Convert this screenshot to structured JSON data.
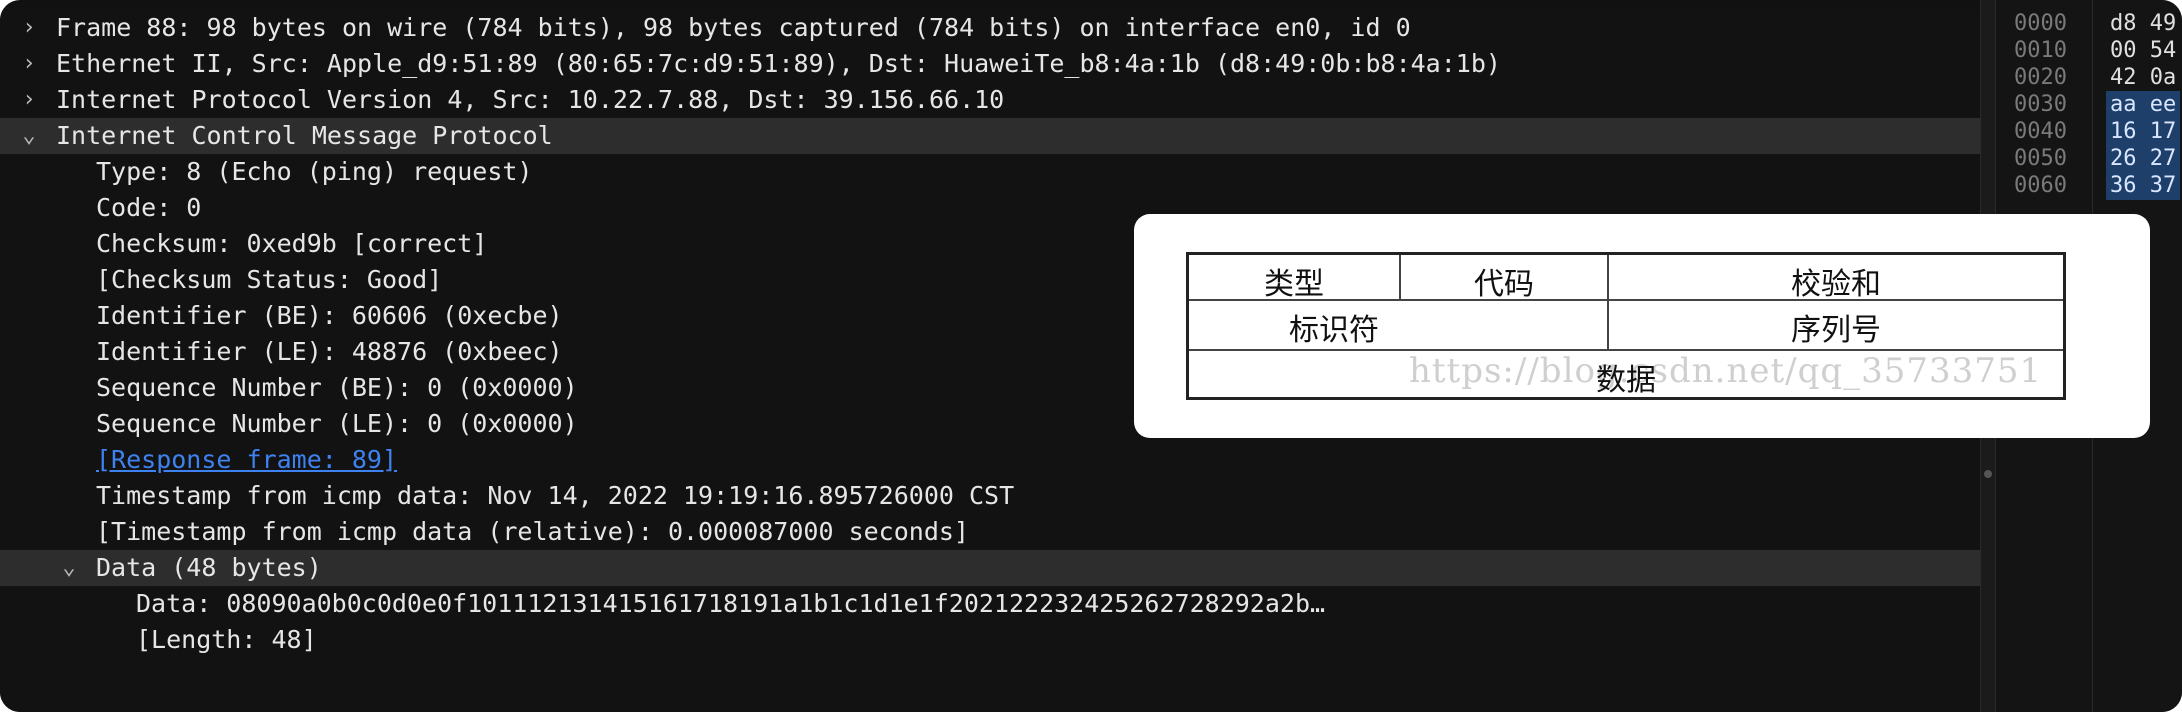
{
  "tree_rows": [
    {
      "text": "Frame 88: 98 bytes on wire (784 bits), 98 bytes captured (784 bits) on interface en0, id 0",
      "chevron": "›",
      "indent": 0
    },
    {
      "text": "Ethernet II, Src: Apple_d9:51:89 (80:65:7c:d9:51:89), Dst: HuaweiTe_b8:4a:1b (d8:49:0b:b8:4a:1b)",
      "chevron": "›",
      "indent": 0
    },
    {
      "text": "Internet Protocol Version 4, Src: 10.22.7.88, Dst: 39.156.66.10",
      "chevron": "›",
      "indent": 0
    },
    {
      "text": "Internet Control Message Protocol",
      "chevron": "⌄",
      "indent": 0
    },
    {
      "text": "Type: 8 (Echo (ping) request)",
      "chevron": "",
      "indent": 1
    },
    {
      "text": "Code: 0",
      "chevron": "",
      "indent": 1
    },
    {
      "text": "Checksum: 0xed9b [correct]",
      "chevron": "",
      "indent": 1
    },
    {
      "text": "[Checksum Status: Good]",
      "chevron": "",
      "indent": 1
    },
    {
      "text": "Identifier (BE): 60606 (0xecbe)",
      "chevron": "",
      "indent": 1
    },
    {
      "text": "Identifier (LE): 48876 (0xbeec)",
      "chevron": "",
      "indent": 1
    },
    {
      "text": "Sequence Number (BE): 0 (0x0000)",
      "chevron": "",
      "indent": 1
    },
    {
      "text": "Sequence Number (LE): 0 (0x0000)",
      "chevron": "",
      "indent": 1
    },
    {
      "text": "[Response frame: 89]",
      "chevron": "",
      "indent": 1,
      "link": true
    },
    {
      "text": "Timestamp from icmp data: Nov 14, 2022 19:19:16.895726000 CST",
      "chevron": "",
      "indent": 1
    },
    {
      "text": "[Timestamp from icmp data (relative): 0.000087000 seconds]",
      "chevron": "",
      "indent": 1
    },
    {
      "text": "Data (48 bytes)",
      "chevron": "⌄",
      "indent": 1
    },
    {
      "text": "Data: 08090a0b0c0d0e0f101112131415161718191a1b1c1d1e1f202122232425262728292a2b…",
      "chevron": "",
      "indent": 2
    },
    {
      "text": "[Length: 48]",
      "chevron": "",
      "indent": 2
    }
  ],
  "hex_rows": [
    {
      "offset": "0000",
      "bytes": "d8 49",
      "highlight": false
    },
    {
      "offset": "0010",
      "bytes": "00 54",
      "highlight": false
    },
    {
      "offset": "0020",
      "bytes": "42 0a",
      "highlight": false
    },
    {
      "offset": "0030",
      "bytes": "aa ee",
      "highlight": true
    },
    {
      "offset": "0040",
      "bytes": "16 17",
      "highlight": true
    },
    {
      "offset": "0050",
      "bytes": "26 27",
      "highlight": true
    },
    {
      "offset": "0060",
      "bytes": "36 37",
      "highlight": true
    }
  ],
  "icmp_figure": {
    "type": "类型",
    "code": "代码",
    "checksum": "校验和",
    "identifier": "标识符",
    "sequence": "序列号",
    "data": "数据",
    "watermark": "https://blog.csdn.net/qq_35733751"
  },
  "colors": {
    "background": "#121212",
    "selected_row": "#2d2d2d",
    "link": "#3d82f0",
    "hex_highlight": "#1f3f6b"
  }
}
